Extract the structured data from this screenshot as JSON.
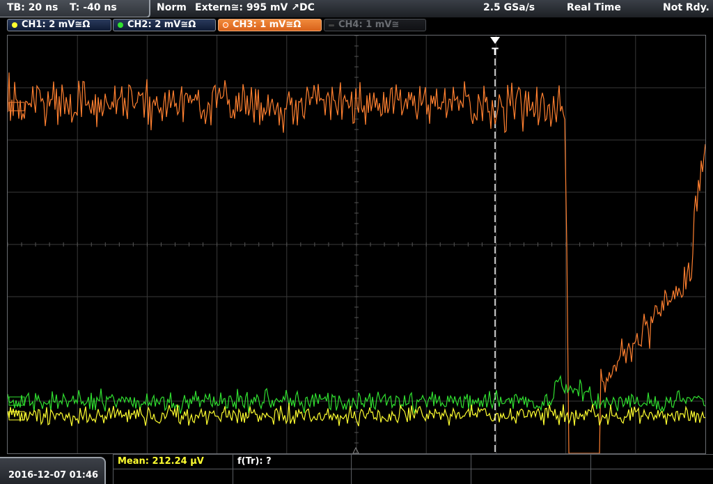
{
  "status": {
    "timebase": "TB: 20 ns",
    "trigger_time": "T: -40 ns",
    "mode": "Norm",
    "trigger": "Extern≅: 995 mV ↗DC",
    "sample_rate": "2.5 GSa/s",
    "acquisition": "Real Time",
    "state": "Not Rdy."
  },
  "channels": [
    {
      "label": "CH1: 2 mV≅Ω",
      "color": "#ffff30",
      "state": "on"
    },
    {
      "label": "CH2: 2 mV≅Ω",
      "color": "#30e030",
      "state": "on"
    },
    {
      "label": "CH3: 1 mV≅Ω",
      "color": "#ff8030",
      "state": "active"
    },
    {
      "label": "CH4: 1 mV≅",
      "color": "#606060",
      "state": "off"
    }
  ],
  "trigger_marker": "T",
  "measurements": {
    "mean": "Mean: 212.24 µV",
    "frequency": "f(Tr): ?"
  },
  "datetime": "2016-12-07 01:46",
  "colors": {
    "ch1": "#ffff30",
    "ch2": "#30e030",
    "ch3": "#ff8030",
    "grid": "#3c3c3c",
    "trigger_line": "#ffffff"
  }
}
